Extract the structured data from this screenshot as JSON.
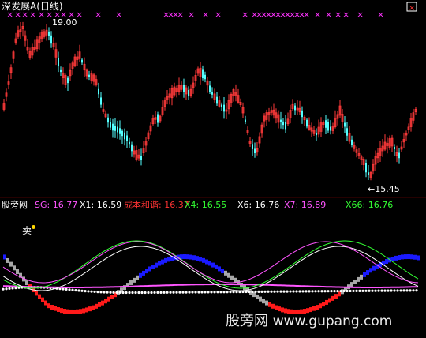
{
  "window": {
    "title": "深发展A",
    "period": "(日线)"
  },
  "price_pane": {
    "high_label": "19.00",
    "low_label": "←15.45",
    "sell_marker": "×",
    "colors": {
      "up": "#ff3a3a",
      "down": "#54ffff",
      "marker": "#ff33ff"
    }
  },
  "indicator": {
    "name": "股旁网",
    "values": [
      {
        "label": "SG:",
        "value": "16.77",
        "color": "#ff55ff"
      },
      {
        "label": "X1:",
        "value": "16.59",
        "color": "#ffffff"
      },
      {
        "label": "成本和谐:",
        "value": "16.37",
        "color": "#ff3333"
      },
      {
        "label": "X4:",
        "value": "16.55",
        "color": "#33ff33"
      },
      {
        "label": "X6:",
        "value": "16.76",
        "color": "#ffffff"
      },
      {
        "label": "X7:",
        "value": "16.89",
        "color": "#ff55ff"
      },
      {
        "label": "X66:",
        "value": "16.76",
        "color": "#33ff33"
      }
    ],
    "sell_label": "卖",
    "colors": {
      "blue": "#1a1aff",
      "red": "#ff1a1a",
      "gray": "#a8a8a8",
      "white": "#ffffff",
      "magenta": "#ff55ff",
      "green": "#33ff33"
    }
  },
  "watermark": {
    "text": "股旁网",
    "url": "www.gupang.com"
  }
}
